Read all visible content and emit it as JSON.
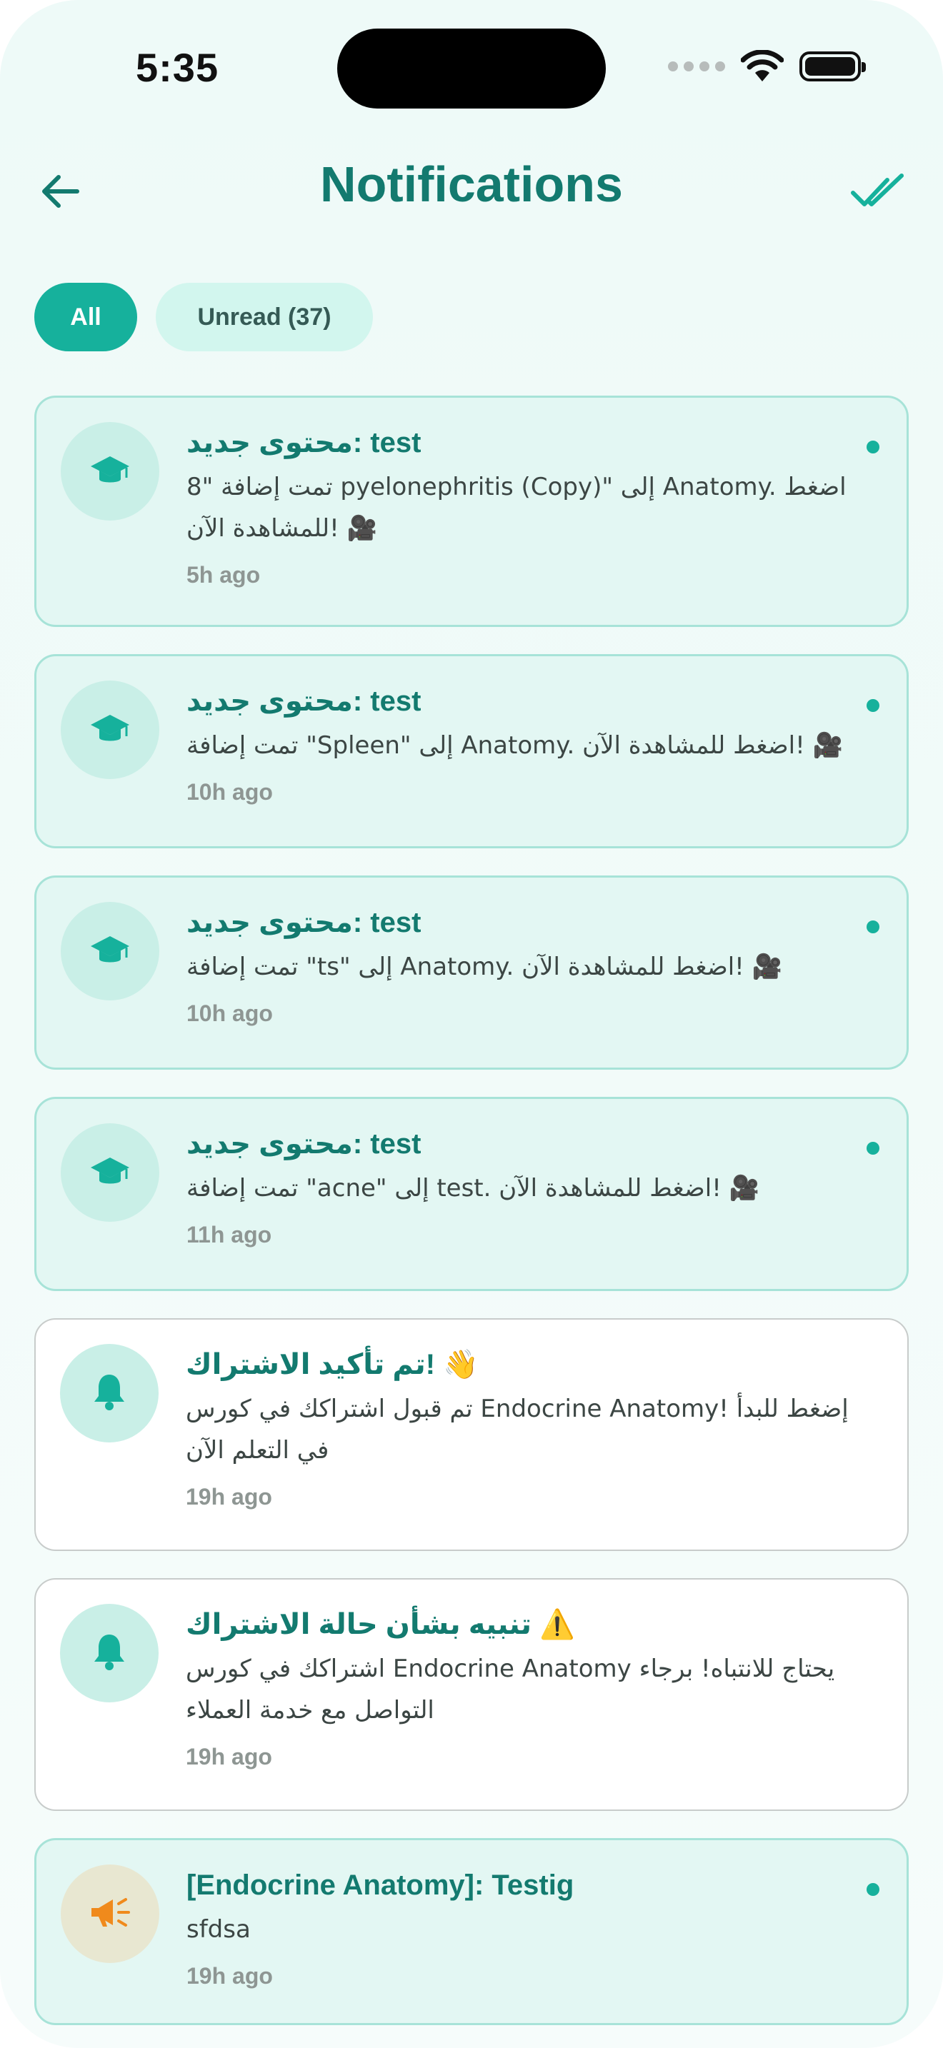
{
  "status_bar": {
    "time": "5:35"
  },
  "header": {
    "title": "Notifications"
  },
  "filters": {
    "all_label": "All",
    "unread_label": "Unread (37)"
  },
  "colors": {
    "accent": "#16b19c",
    "title": "#137a6f",
    "unread_bg": "#e3f7f3",
    "read_bg": "#ffffff"
  },
  "notifications": [
    {
      "icon": "graduation-cap-icon",
      "title": "محتوى جديد: test",
      "body": "تمت إضافة \"8 pyelonephritis  (Copy)\" إلى Anatomy. اضغط للمشاهدة الآن! 🎥",
      "time": "5h ago",
      "unread": true
    },
    {
      "icon": "graduation-cap-icon",
      "title": "محتوى جديد: test",
      "body": "تمت إضافة \"Spleen\" إلى Anatomy. اضغط للمشاهدة الآن! 🎥",
      "time": "10h ago",
      "unread": true
    },
    {
      "icon": "graduation-cap-icon",
      "title": "محتوى جديد: test",
      "body": "تمت إضافة \"ts\" إلى Anatomy. اضغط للمشاهدة الآن! 🎥",
      "time": "10h ago",
      "unread": true
    },
    {
      "icon": "graduation-cap-icon",
      "title": "محتوى جديد: test",
      "body": "تمت إضافة \"acne\" إلى test. اضغط للمشاهدة الآن! 🎥",
      "time": "11h ago",
      "unread": true
    },
    {
      "icon": "bell-icon",
      "title": "تم تأكيد الاشتراك! 👋",
      "body": "تم قبول اشتراكك في كورس Endocrine Anatomy! إضغط للبدأ في التعلم الآن",
      "time": "19h ago",
      "unread": false
    },
    {
      "icon": "bell-icon",
      "title": "تنبيه بشأن حالة الاشتراك ⚠️",
      "body": "اشتراكك في كورس Endocrine Anatomy يحتاج للانتباه! برجاء التواصل مع خدمة العملاء",
      "time": "19h ago",
      "unread": false
    },
    {
      "icon": "megaphone-icon",
      "title": "[Endocrine Anatomy]: Testig",
      "body": "sfdsa",
      "time": "19h ago",
      "unread": true
    }
  ]
}
